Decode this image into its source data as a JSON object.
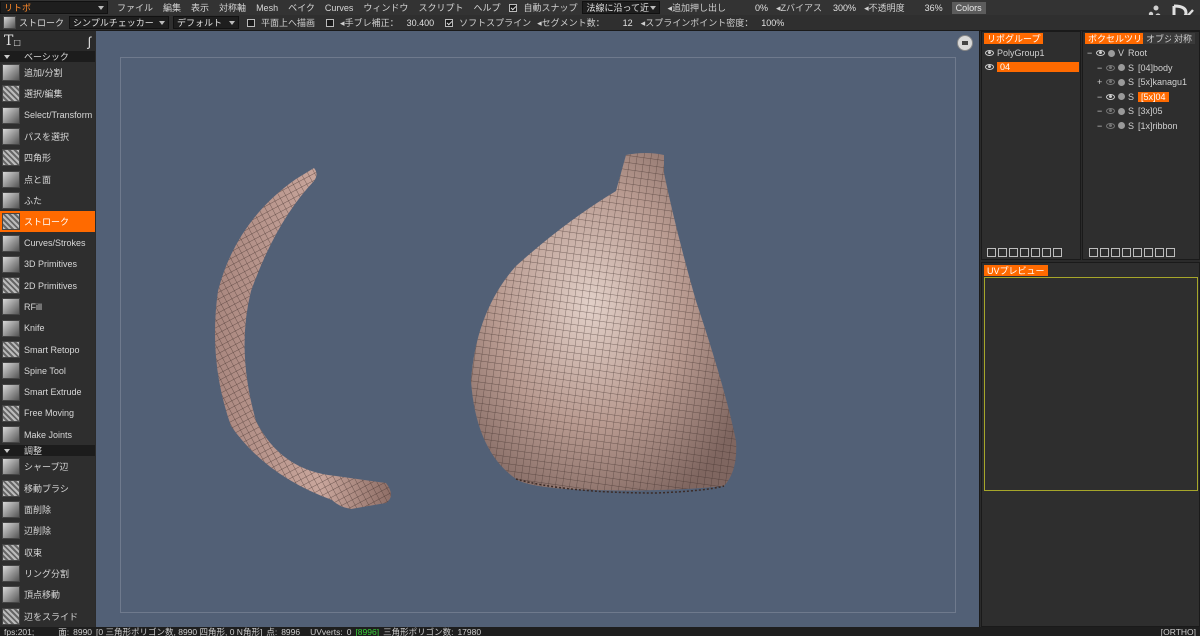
{
  "menubar": {
    "mode_select": "リトポ",
    "items": [
      "ファイル",
      "編集",
      "表示",
      "対称軸",
      "Mesh",
      "ベイク",
      "Curves",
      "ウィンドウ",
      "スクリプト",
      "ヘルプ"
    ],
    "auto_snap_label": "自動スナップ",
    "snap_mode_select": "法線に沿って近",
    "extrude_label": "追加押し出し",
    "extrude_value": "0%",
    "zbias_label": "Zバイアス",
    "zbias_value": "300%",
    "opacity_label": "不透明度",
    "opacity_value": "36%",
    "colors_button": "Colors"
  },
  "toolbar": {
    "tool_label": "ストローク",
    "checker_select": "シンプルチェッカー",
    "preset_select": "デフォルト",
    "draw_on_plane_label": "平面上へ描画",
    "stabilizer_label": "手ブレ補正：",
    "stabilizer_value": "30.400",
    "soft_spline_label": "ソフトスプライン",
    "segments_label": "セグメント数：",
    "segments_value": "12",
    "spline_density_label": "スプラインポイント密度：",
    "spline_density_value": "100%"
  },
  "left_panel": {
    "section_basic": "ベーシック",
    "section_adjust": "調整",
    "basic_tools": [
      "追加/分割",
      "選択/編集",
      "Select/Transform",
      "パスを選択",
      "四角形",
      "点と面",
      "ふた",
      "ストローク",
      "Curves/Strokes",
      "3D  Primitives",
      "2D  Primitives",
      "RFill",
      "Knife",
      "Smart  Retopo",
      "Spine  Tool",
      "Smart  Extrude",
      "Free  Moving",
      "Make  Joints"
    ],
    "active_tool": "ストローク",
    "adjust_tools": [
      "シャープ辺",
      "移動ブラシ",
      "面削除",
      "辺削除",
      "収束",
      "リング分割",
      "頂点移動",
      "辺をスライド"
    ]
  },
  "retopo_groups": {
    "tab": "リポグループ",
    "items": [
      {
        "name": "PolyGroup1",
        "selected": false
      },
      {
        "name": "04",
        "selected": true
      }
    ]
  },
  "voxel_tree": {
    "tabs": [
      "ボクセルツリー",
      "オブジ",
      "対称"
    ],
    "items": [
      {
        "prefix": "−",
        "type": "V",
        "name": "Root",
        "selected": false
      },
      {
        "prefix": "−",
        "type": "S",
        "name": "[04]body",
        "selected": false
      },
      {
        "prefix": "+",
        "type": "S",
        "name": "[5x]kanagu1",
        "selected": false
      },
      {
        "prefix": "−",
        "type": "S",
        "name": "[5x]04",
        "selected": true
      },
      {
        "prefix": "−",
        "type": "S",
        "name": "[3x]05",
        "selected": false
      },
      {
        "prefix": "−",
        "type": "S",
        "name": "[1x]ribbon",
        "selected": false
      }
    ]
  },
  "uv_preview": {
    "tab": "UVプレビュー"
  },
  "status_bar": {
    "fps": "fps:201;",
    "faces_label": "面:",
    "faces": "8990",
    "breakdown": "[0  三角形ポリゴン数, 8990  四角形, 0  N角形]",
    "points_label": "点:",
    "points": "8996",
    "uv_label": "UVverts:",
    "uv_value": "0",
    "uv_highlight": "[8996]",
    "tri_label": "三角形ポリゴン数:",
    "tri_value": "17980",
    "projection": "[ORTHO]"
  },
  "colors": {
    "accent": "#ff6a00",
    "viewport_bg": "#526076",
    "panel_bg": "#2e2e2e",
    "mesh_fill": "#b89a90",
    "mesh_wire": "#3b2b27",
    "uv_border": "#a6a62a"
  }
}
